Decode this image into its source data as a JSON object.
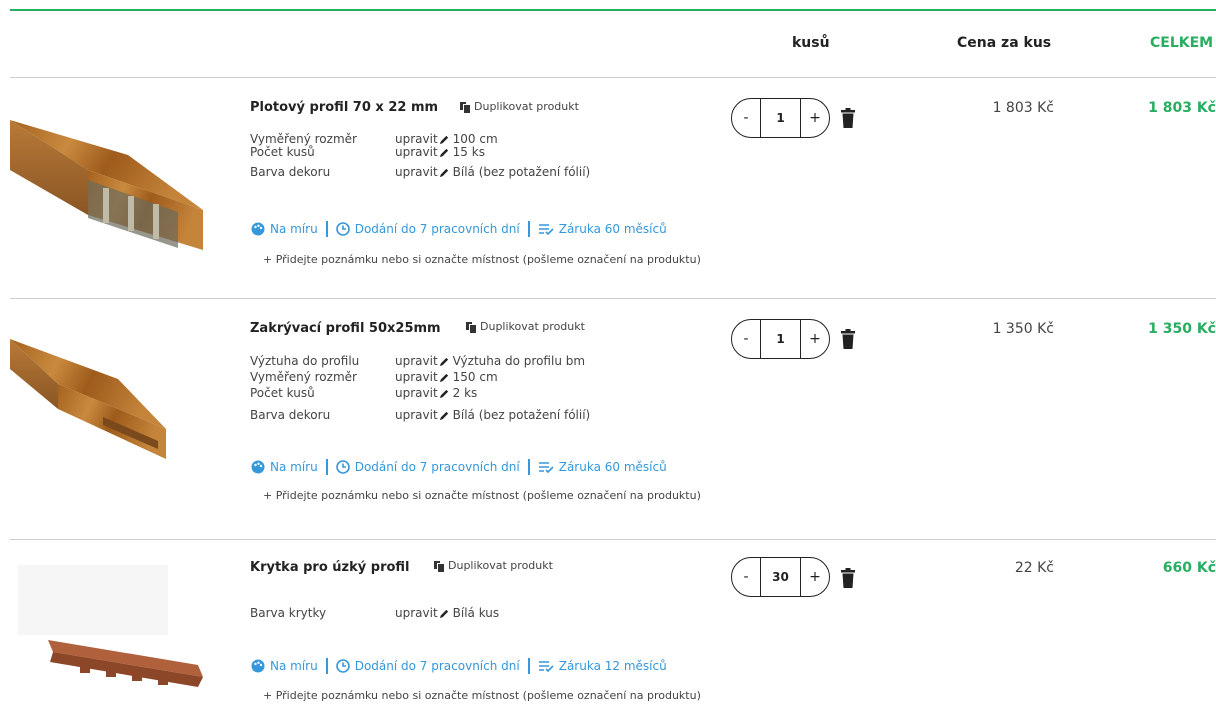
{
  "header": {
    "qty_label": "kusů",
    "price_label": "Cena za kus",
    "total_label": "CELKEM"
  },
  "colors": {
    "accent": "#27ae60",
    "link": "#3498db"
  },
  "common": {
    "duplicate": "Duplikovat produkt",
    "edit": "upravit",
    "feature_custom": "Na míru",
    "feature_delivery": "Dodání do 7 pracovních dní",
    "note": "+ Přidejte poznámku nebo si označte místnost (pošleme označení na produktu)"
  },
  "items": [
    {
      "name": "Plotový profil 70 x 22 mm",
      "attrs": [
        {
          "label": "Vyměřený rozměr",
          "value": "100 cm"
        },
        {
          "label": "Počet kusů",
          "value": "15 ks"
        },
        {
          "label": "Barva dekoru",
          "value": "Bílá (bez potažení fólií)"
        }
      ],
      "warranty": "Záruka 60 měsíců",
      "qty": "1",
      "price": "1 803 Kč",
      "total": "1 803 Kč"
    },
    {
      "name": "Zakrývací profil 50x25mm",
      "attrs": [
        {
          "label": "Výztuha do profilu",
          "value": "Výztuha do profilu bm"
        },
        {
          "label": "Vyměřený rozměr",
          "value": "150 cm"
        },
        {
          "label": "Počet kusů",
          "value": "2 ks"
        },
        {
          "label": "Barva dekoru",
          "value": "Bílá (bez potažení fólií)"
        }
      ],
      "warranty": "Záruka 60 měsíců",
      "qty": "1",
      "price": "1 350 Kč",
      "total": "1 350 Kč"
    },
    {
      "name": "Krytka pro úzký profil",
      "attrs": [
        {
          "label": "Barva krytky",
          "value": "Bílá kus"
        }
      ],
      "warranty": "Záruka 12 měsíců",
      "qty": "30",
      "price": "22 Kč",
      "total": "660 Kč"
    }
  ]
}
